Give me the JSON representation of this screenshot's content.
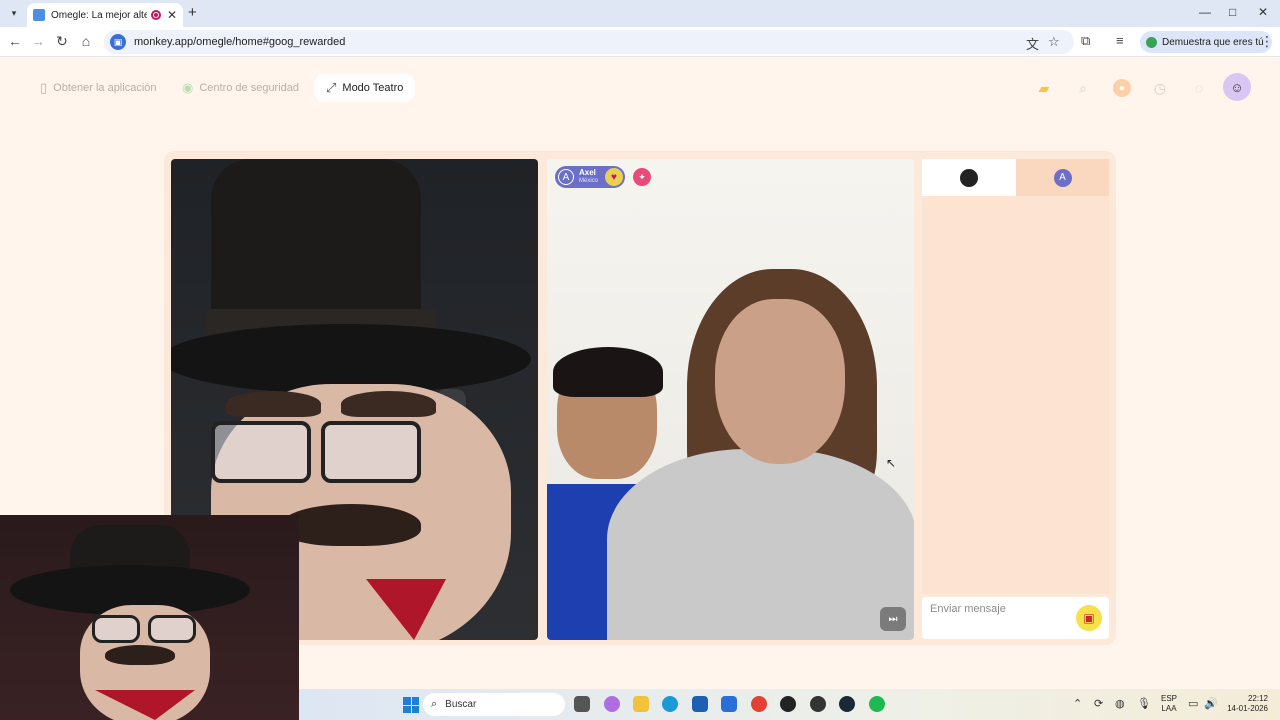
{
  "browser": {
    "tab_title": "Omegle: La mejor alternativa",
    "tab_close": "✕",
    "new_tab": "+",
    "url": "monkey.app/omegle/home#goog_rewarded",
    "human_chip": "Demuestra que eres tú",
    "window_controls": [
      "—",
      "□",
      "✕"
    ]
  },
  "header": {
    "get_app": "Obtener la aplicación",
    "safety_center": "Centro de seguridad",
    "theater_mode": "Modo Teatro"
  },
  "peer": {
    "initial": "A",
    "name": "Axel",
    "country": "México"
  },
  "chat": {
    "peer_initial": "A",
    "placeholder": "Enviar mensaje"
  },
  "taskbar": {
    "search_label": "Buscar",
    "lang_line1": "ESP",
    "lang_line2": "LAA",
    "time": "22:12",
    "date": "14-01-2026"
  },
  "icons": {
    "theater": "theater-mode-icon",
    "search": "search-icon",
    "history": "history-icon",
    "chat": "chat-icon",
    "gift": "gift-icon",
    "skip": "skip-icon"
  },
  "colors": {
    "page_bg": "#fff5ec",
    "stage_bg": "#fde9da",
    "peer_tag": "#6b6fc7",
    "gift": "#f6e14a"
  }
}
